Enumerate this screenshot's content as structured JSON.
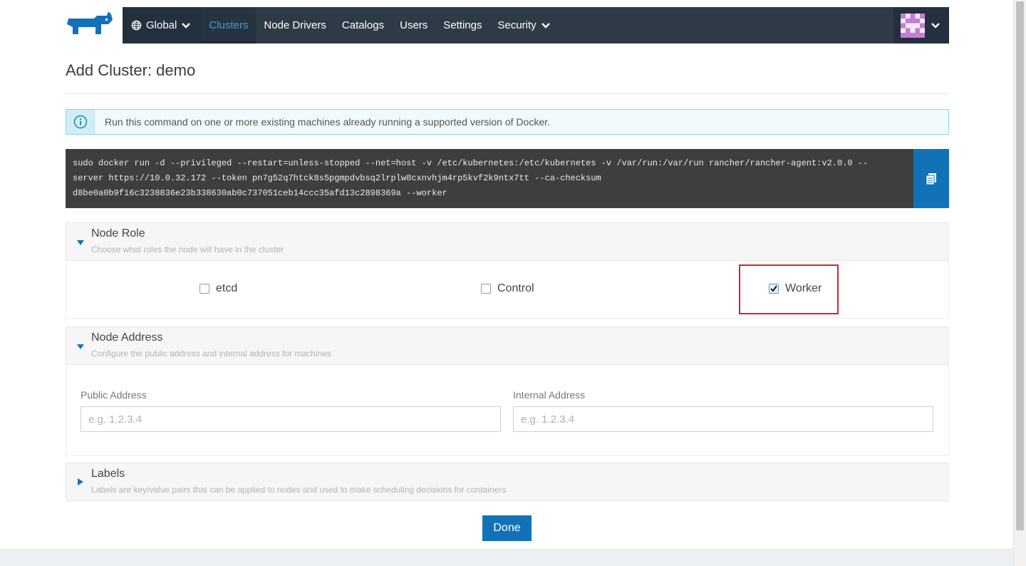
{
  "nav": {
    "global_label": "Global",
    "items": [
      "Clusters",
      "Node Drivers",
      "Catalogs",
      "Users",
      "Settings",
      "Security"
    ],
    "active_index": 0
  },
  "page": {
    "title": "Add Cluster: demo"
  },
  "info": {
    "text": "Run this command on one or more existing machines already running a supported version of Docker."
  },
  "command": {
    "lines": [
      "sudo docker run -d --privileged --restart=unless-stopped --net=host -v /etc/kubernetes:/etc/kubernetes -v /var/run:/var/run rancher/rancher-agent:v2.0.0 --",
      "server https://10.0.32.172 --token pn7g52q7htck8s5pgmpdvbsq2lrplw8cxnvhjm4rp5kvf2k9ntx7tt --ca-checksum",
      "d8be0a0b9f16c3238836e23b338630ab0c737051ceb14ccc35afd13c2898369a --worker"
    ]
  },
  "node_role": {
    "title": "Node Role",
    "description": "Choose what roles the node will have in the cluster",
    "roles": [
      {
        "label": "etcd",
        "checked": false
      },
      {
        "label": "Control",
        "checked": false
      },
      {
        "label": "Worker",
        "checked": true
      }
    ]
  },
  "node_address": {
    "title": "Node Address",
    "description": "Configure the public address and internal address for machines",
    "public_label": "Public Address",
    "public_placeholder": "e.g. 1.2.3.4",
    "public_value": "",
    "internal_label": "Internal Address",
    "internal_placeholder": "e.g. 1.2.3.4",
    "internal_value": ""
  },
  "labels_section": {
    "title": "Labels",
    "description": "Labels are key/value pairs that can be applied to nodes and used to make scheduling decisions for containers"
  },
  "actions": {
    "done_label": "Done"
  },
  "colors": {
    "nav_bg": "#2f3a47",
    "accent": "#1272b8",
    "active_nav": "#3d9fd6",
    "highlight": "#d3242c"
  },
  "icons": {
    "logo": "rancher-cow-logo",
    "globe": "globe-icon",
    "copy": "clipboard-icon",
    "info": "info-icon"
  }
}
